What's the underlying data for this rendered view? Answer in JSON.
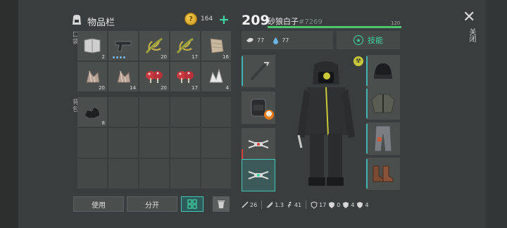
{
  "inventory": {
    "title": "物品栏",
    "coins": "164",
    "pocket_label": "口袋",
    "backpack_label": "背包",
    "pocket_slots": [
      {
        "icon": "notebook-icon",
        "qty": "2"
      },
      {
        "icon": "pistol-icon",
        "qty": ""
      },
      {
        "icon": "plant-fiber-icon",
        "qty": "20"
      },
      {
        "icon": "plant-fiber-icon",
        "qty": "17"
      },
      {
        "icon": "cloth-scrap-icon",
        "qty": "16"
      },
      {
        "icon": "ore-crystal-icon",
        "qty": "20"
      },
      {
        "icon": "ore-crystal-icon",
        "qty": "14"
      },
      {
        "icon": "red-mushroom-icon",
        "qty": "20"
      },
      {
        "icon": "red-mushroom-icon",
        "qty": "17"
      },
      {
        "icon": "white-crystal-icon",
        "qty": "4"
      }
    ],
    "backpack_slots": [
      {
        "icon": "coal-icon",
        "qty": "8"
      }
    ],
    "buttons": {
      "use": "使用",
      "split": "分开"
    }
  },
  "character": {
    "level": "209",
    "name": "砂狼白子",
    "id": "#7269",
    "hp_value": "120",
    "hp_fraction": 1.0,
    "hunger": "77",
    "thirst": "77",
    "skill_label": "技能",
    "footer": {
      "attack": "26",
      "attack_speed": "1.3",
      "speed": "41",
      "armor": "17",
      "res1": "0",
      "res2": "4",
      "res3": "4"
    }
  },
  "close_label": "关闭",
  "colors": {
    "accent": "#3fd6a4",
    "hp": "#4cc76b",
    "equip_bar": "#3fb5b5",
    "danger": "#d8443a"
  }
}
